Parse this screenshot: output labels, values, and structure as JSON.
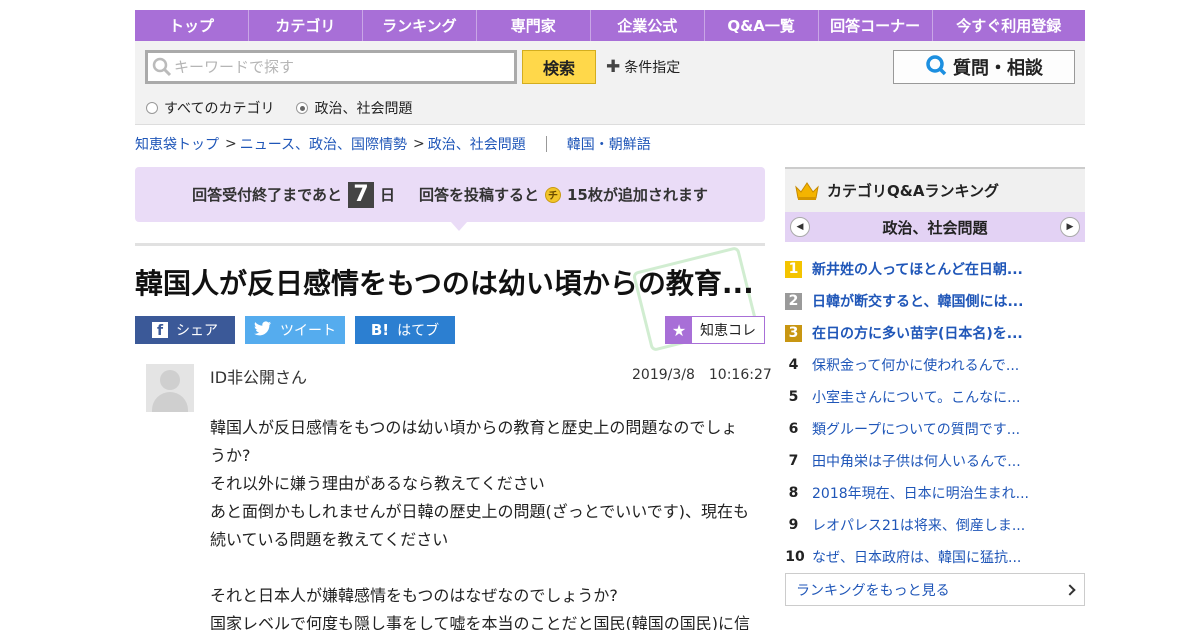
{
  "nav": [
    "トップ",
    "カテゴリ",
    "ランキング",
    "専門家",
    "企業公式",
    "Q&A一覧",
    "回答コーナー",
    "今すぐ利用登録"
  ],
  "search": {
    "placeholder": "キーワードで探す",
    "button": "検索",
    "condition": "条件指定",
    "ask_button": "質問・相談",
    "radio_all": "すべてのカテゴリ",
    "radio_current": "政治、社会問題"
  },
  "breadcrumb": [
    "知恵袋トップ",
    "ニュース、政治、国際情勢",
    "政治、社会問題"
  ],
  "breadcrumb_tag": "韓国・朝鮮語",
  "notice": {
    "before": "回答受付終了まであと",
    "days": "7",
    "day_unit": "日",
    "middle": "回答を投稿すると",
    "coin": "チ",
    "after": "15枚が追加されます"
  },
  "question": {
    "title": "韓国人が反日感情をもつのは幼い頃からの教育...",
    "user": "ID非公開さん",
    "date": "2019/3/8　10:16:27",
    "body_lines": [
      "韓国人が反日感情をもつのは幼い頃からの教育と歴史上の問題なのでしょ",
      "うか?",
      "それ以外に嫌う理由があるなら教えてください",
      "あと面倒かもしれませんが日韓の歴史上の問題(ざっとでいいです)、現在も",
      "続いている問題を教えてください",
      "",
      "それと日本人が嫌韓感情をもつのはなぜなのでしょうか?",
      "国家レベルで何度も隠し事をして嘘を本当のことだと国民(韓国の国民)に信"
    ]
  },
  "share": {
    "facebook": "シェア",
    "twitter": "ツイート",
    "hatena_mark": "B!",
    "hatena": "はてブ",
    "chiekore": "知恵コレ"
  },
  "ranking": {
    "heading": "カテゴリQ&Aランキング",
    "category": "政治、社会問題",
    "items": [
      {
        "rank": "1",
        "text": "新井姓の人ってほとんど在日朝..."
      },
      {
        "rank": "2",
        "text": "日韓が断交すると、韓国側には..."
      },
      {
        "rank": "3",
        "text": "在日の方に多い苗字(日本名)を..."
      },
      {
        "rank": "4",
        "text": "保釈金って何かに使われるんで..."
      },
      {
        "rank": "5",
        "text": "小室圭さんについて。こんなに..."
      },
      {
        "rank": "6",
        "text": "類グループについての質問です..."
      },
      {
        "rank": "7",
        "text": "田中角栄は子供は何人いるんで..."
      },
      {
        "rank": "8",
        "text": "2018年現在、日本に明治生まれ..."
      },
      {
        "rank": "9",
        "text": "レオパレス21は将来、倒産しま..."
      },
      {
        "rank": "10",
        "text": "なぜ、日本政府は、韓国に猛抗..."
      }
    ],
    "more": "ランキングをもっと見る"
  },
  "colors": {
    "nav": "#a86fd7",
    "link": "#1f56b8",
    "search_button": "#ffd84a",
    "notice_bg": "#eadcf7"
  }
}
